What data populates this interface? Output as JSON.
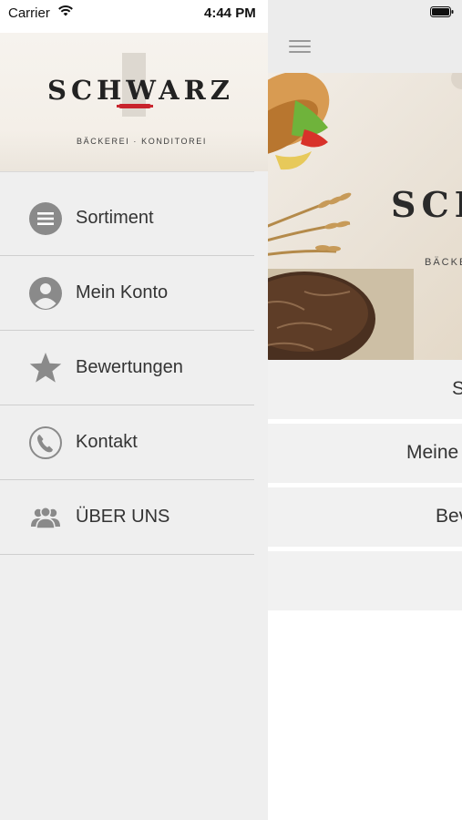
{
  "status_bar": {
    "carrier": "Carrier",
    "time": "4:44 PM"
  },
  "drawer": {
    "header": {
      "brand": "SCHWARZ",
      "tagline": "BÄCKEREI · KONDITOREI"
    },
    "items": [
      {
        "label": "Sortiment",
        "icon": "list-icon"
      },
      {
        "label": "Mein Konto",
        "icon": "user-icon"
      },
      {
        "label": "Bewertungen",
        "icon": "star-icon"
      },
      {
        "label": "Kontakt",
        "icon": "phone-icon"
      },
      {
        "label": "ÜBER UNS",
        "icon": "group-icon"
      }
    ]
  },
  "main": {
    "hero": {
      "brand_partial": "SCH",
      "tagline_partial": "BÄCKE"
    },
    "rows": [
      "S",
      "Meine",
      "Bev"
    ]
  },
  "colors": {
    "icon_gray": "#8a8a8a",
    "accent_red": "#c8232c"
  }
}
